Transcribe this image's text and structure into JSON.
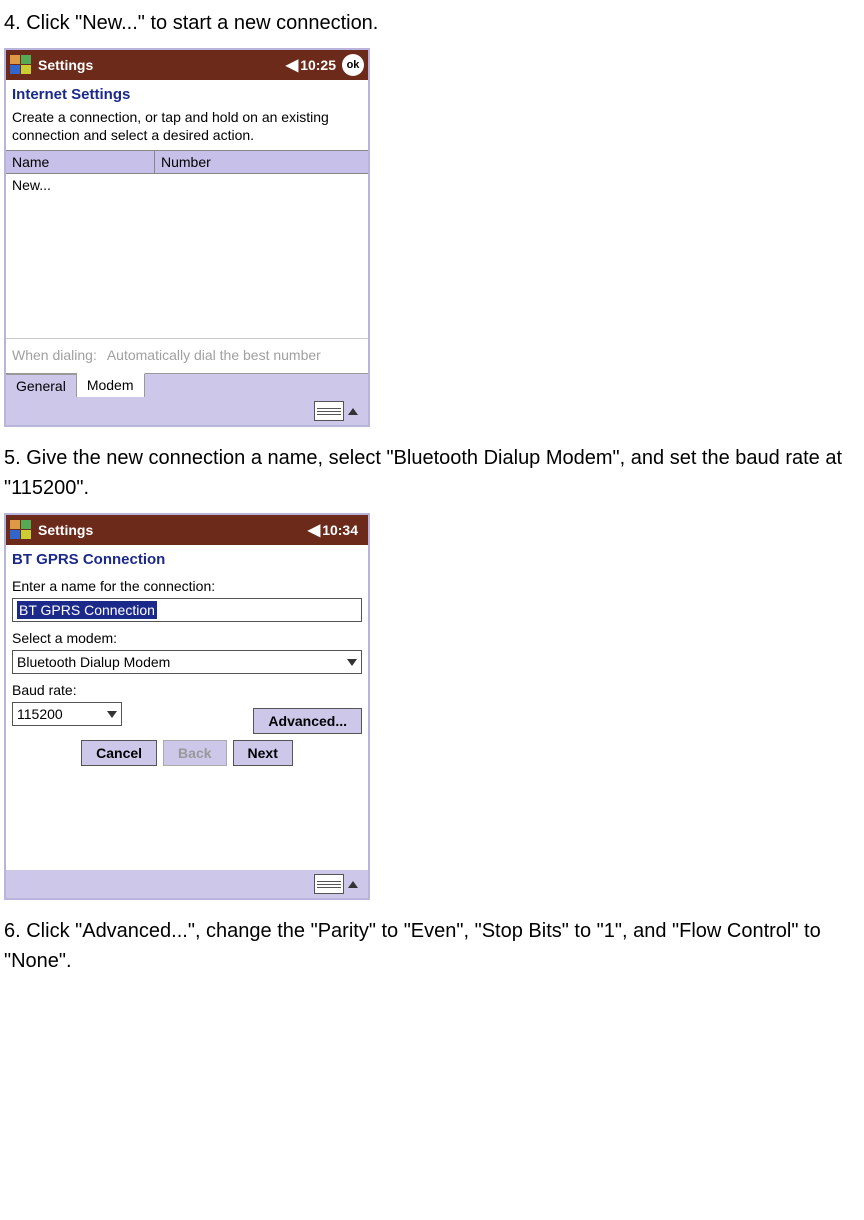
{
  "steps": {
    "step4": "4. Click \"New...\" to start a new connection.",
    "step5": "5. Give the new connection a name, select \"Bluetooth Dialup Modem\", and set the baud rate at \"115200\".",
    "step6": "6. Click \"Advanced...\", change the \"Parity\" to \"Even\", \"Stop Bits\" to \"1\", and \"Flow Control\" to \"None\"."
  },
  "screen1": {
    "title": "Settings",
    "time": "10:25",
    "ok": "ok",
    "heading": "Internet Settings",
    "desc": "Create a connection, or tap and hold on an existing connection and select a desired action.",
    "col_name": "Name",
    "col_number": "Number",
    "row_new": "New...",
    "when_label": "When dialing:",
    "when_value": "Automatically dial the best number",
    "tab_general": "General",
    "tab_modem": "Modem"
  },
  "screen2": {
    "title": "Settings",
    "time": "10:34",
    "heading": "BT GPRS Connection",
    "name_label": "Enter a name for the connection:",
    "name_value": "BT GPRS Connection",
    "modem_label": "Select a modem:",
    "modem_value": "Bluetooth Dialup Modem",
    "baud_label": "Baud rate:",
    "baud_value": "115200",
    "btn_advanced": "Advanced...",
    "btn_cancel": "Cancel",
    "btn_back": "Back",
    "btn_next": "Next"
  }
}
